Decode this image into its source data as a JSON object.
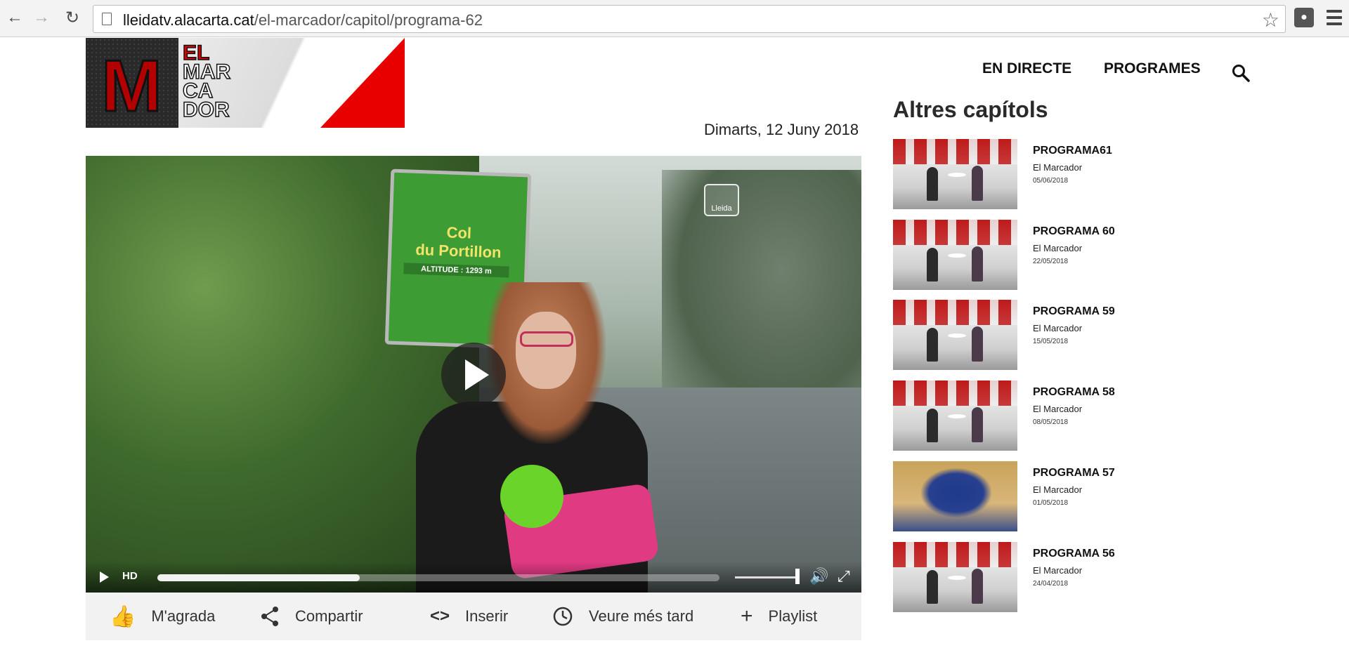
{
  "browser": {
    "url_host": "lleidatv.alacarta.cat",
    "url_path": "/el-marcador/capitol/programa-62"
  },
  "logo": {
    "line1": "EL",
    "line2": "MAR",
    "line3": "CA",
    "line4": "DOR",
    "monogram": "M"
  },
  "nav": {
    "live": "EN DIRECTE",
    "programs": "PROGRAMES"
  },
  "episode": {
    "date": "Dimarts, 12 Juny 2018"
  },
  "video": {
    "sign_line1": "Col",
    "sign_line2": "du Portillon",
    "sign_altitude": "ALTITUDE : 1293 m",
    "bug": "Lleida",
    "hd_label": "HD",
    "progress": 0.36
  },
  "actions": {
    "like": "M'agrada",
    "share": "Compartir",
    "embed": "Inserir",
    "later": "Veure més tard",
    "playlist": "Playlist"
  },
  "sidebar": {
    "title": "Altres capítols",
    "episodes": [
      {
        "title": "PROGRAMA61",
        "program": "El Marcador",
        "date": "05/06/2018"
      },
      {
        "title": "PROGRAMA 60",
        "program": "El Marcador",
        "date": "22/05/2018"
      },
      {
        "title": "PROGRAMA 59",
        "program": "El Marcador",
        "date": "15/05/2018"
      },
      {
        "title": "PROGRAMA 58",
        "program": "El Marcador",
        "date": "08/05/2018"
      },
      {
        "title": "PROGRAMA 57",
        "program": "El Marcador",
        "date": "01/05/2018"
      },
      {
        "title": "PROGRAMA 56",
        "program": "El Marcador",
        "date": "24/04/2018"
      }
    ]
  }
}
